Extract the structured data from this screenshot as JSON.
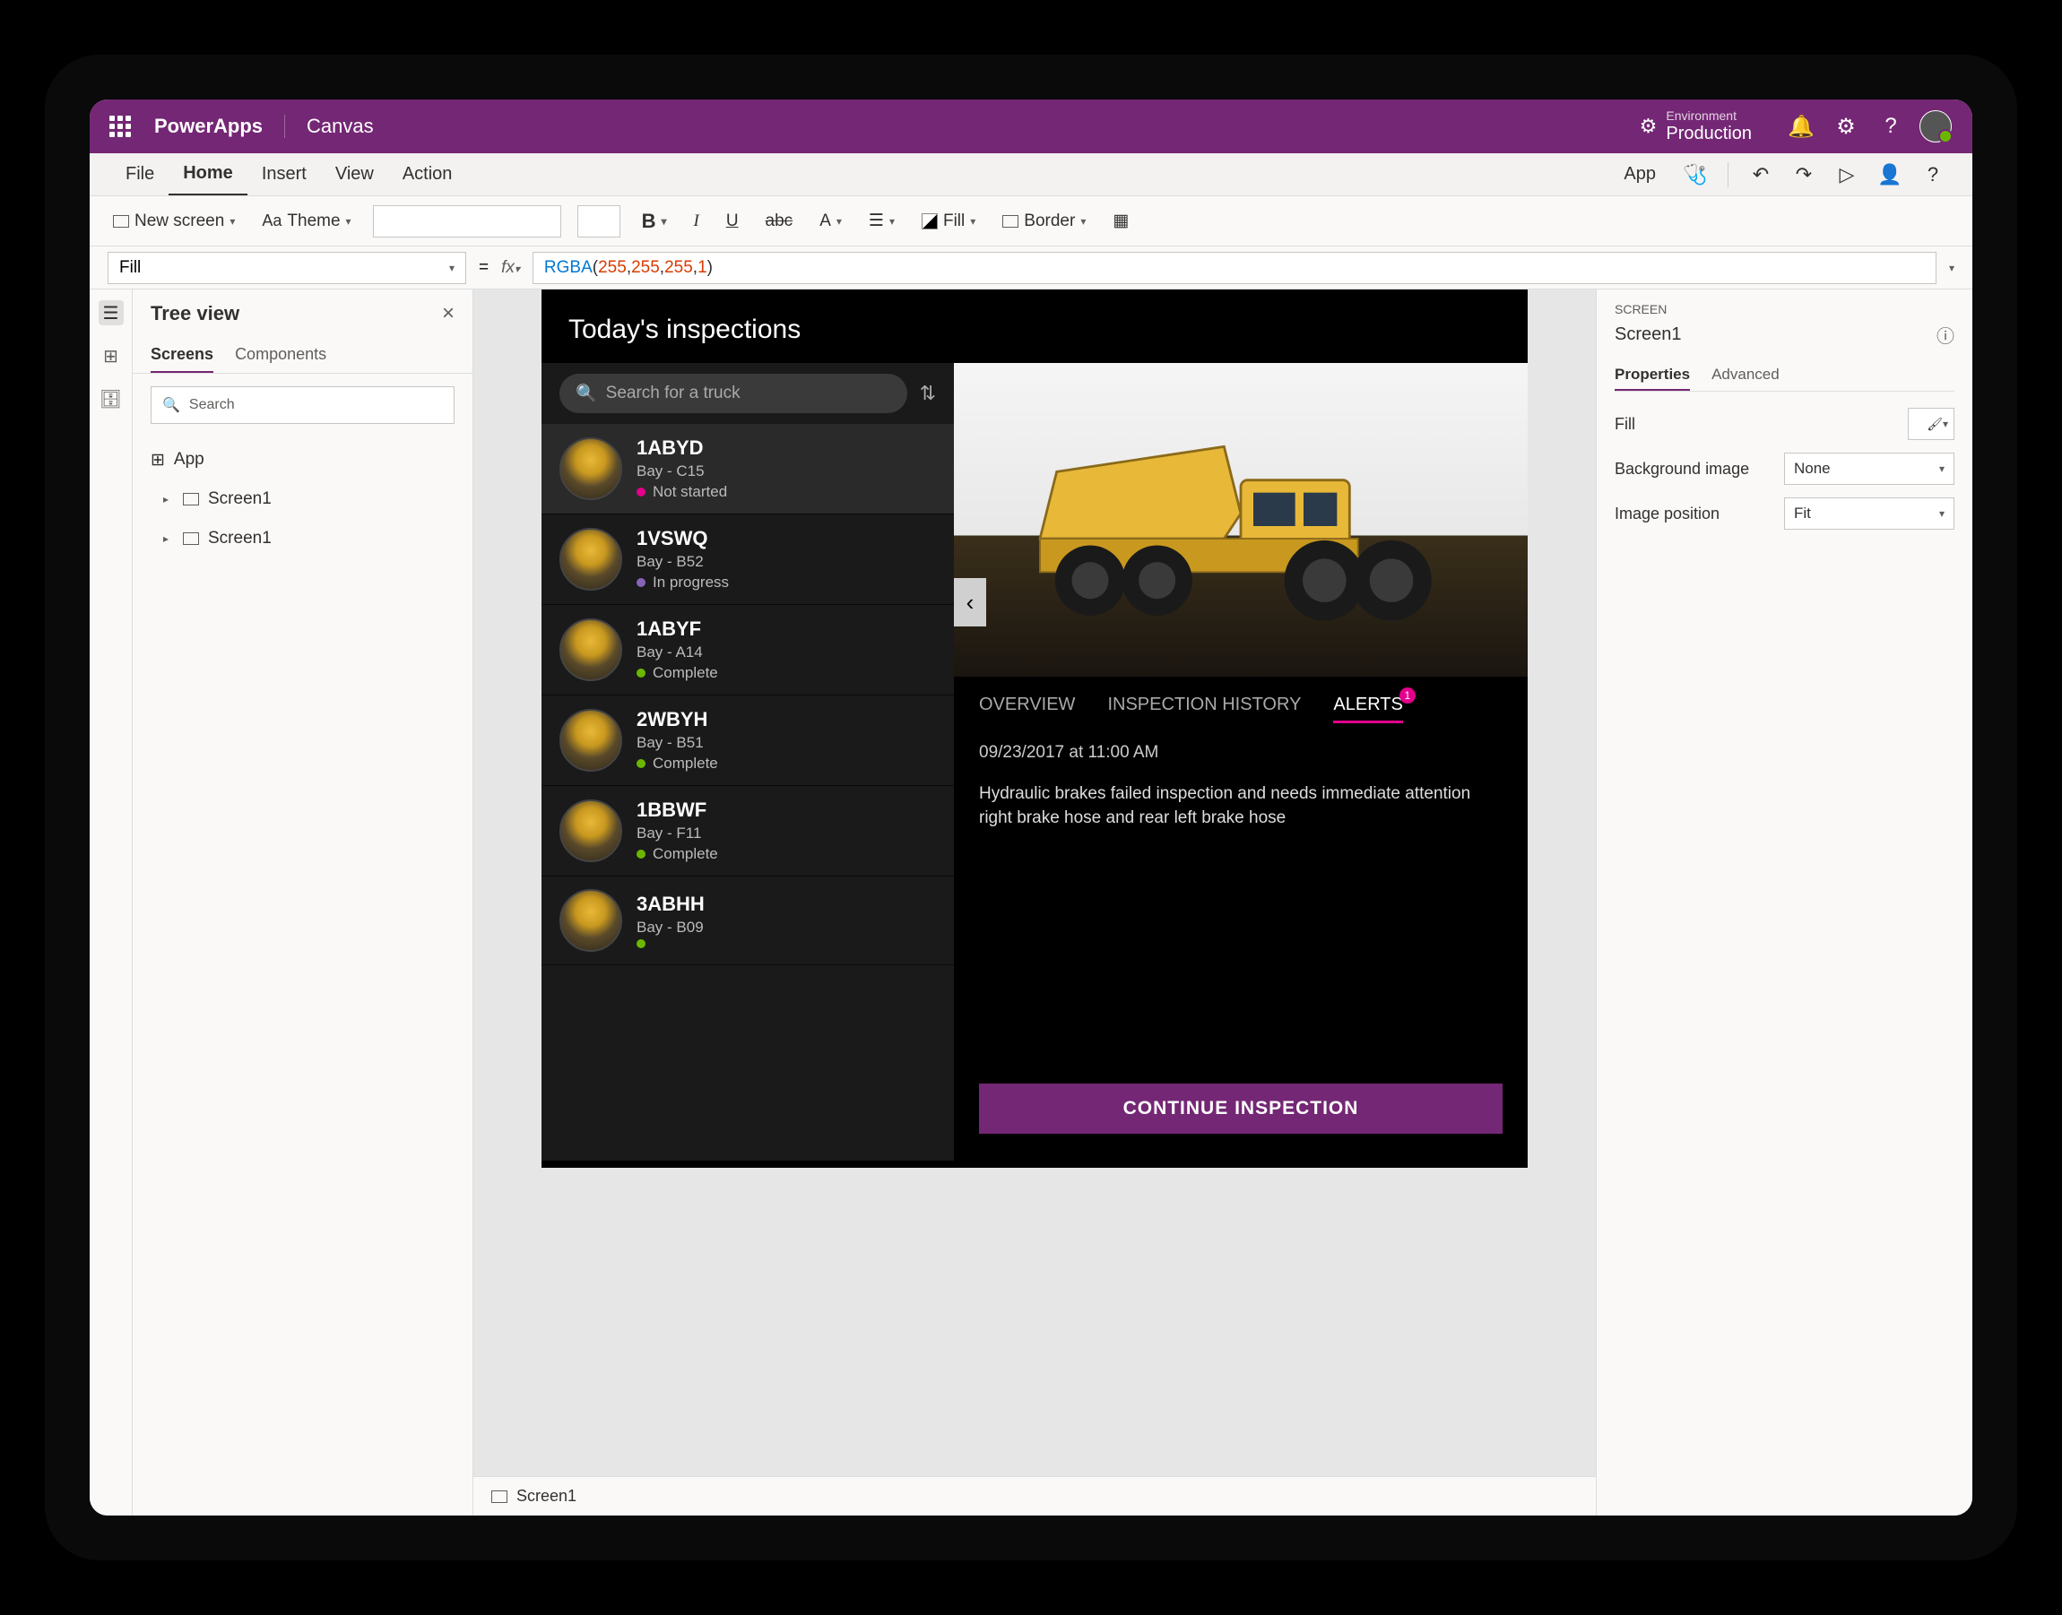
{
  "titlebar": {
    "brand": "PowerApps",
    "doctype": "Canvas",
    "env_label": "Environment",
    "env_name": "Production"
  },
  "menubar": {
    "items": [
      "File",
      "Home",
      "Insert",
      "View",
      "Action"
    ],
    "active": "Home",
    "app_label": "App"
  },
  "toolbar": {
    "newscreen": "New screen",
    "theme": "Theme",
    "fill": "Fill",
    "border": "Border"
  },
  "formula": {
    "property": "Fill",
    "fn": "RGBA",
    "args": [
      "255",
      "255",
      "255",
      "1"
    ]
  },
  "tree": {
    "title": "Tree view",
    "tabs": [
      "Screens",
      "Components"
    ],
    "active": "Screens",
    "search": "Search",
    "app": "App",
    "screens": [
      "Screen1",
      "Screen1"
    ]
  },
  "app": {
    "title": "Today's inspections",
    "search_placeholder": "Search for a truck",
    "trucks": [
      {
        "name": "1ABYD",
        "bay": "Bay - C15",
        "status": "Not started",
        "dot": "pink",
        "sel": true
      },
      {
        "name": "1VSWQ",
        "bay": "Bay - B52",
        "status": "In progress",
        "dot": "purple"
      },
      {
        "name": "1ABYF",
        "bay": "Bay - A14",
        "status": "Complete",
        "dot": "green"
      },
      {
        "name": "2WBYH",
        "bay": "Bay - B51",
        "status": "Complete",
        "dot": "green"
      },
      {
        "name": "1BBWF",
        "bay": "Bay - F11",
        "status": "Complete",
        "dot": "green"
      },
      {
        "name": "3ABHH",
        "bay": "Bay - B09",
        "status": "",
        "dot": "green"
      }
    ],
    "detail": {
      "tabs": [
        "OVERVIEW",
        "INSPECTION HISTORY",
        "ALERTS"
      ],
      "active": "ALERTS",
      "alert_badge": "1",
      "timestamp": "09/23/2017 at 11:00 AM",
      "desc": "Hydraulic brakes failed inspection and needs immediate attention right brake hose and rear left brake hose",
      "button": "CONTINUE INSPECTION"
    }
  },
  "statusbar": {
    "screen": "Screen1"
  },
  "proppanel": {
    "label": "SCREEN",
    "name": "Screen1",
    "tabs": [
      "Properties",
      "Advanced"
    ],
    "active": "Properties",
    "rows": [
      {
        "label": "Fill",
        "type": "color"
      },
      {
        "label": "Background image",
        "type": "select",
        "value": "None"
      },
      {
        "label": "Image position",
        "type": "select",
        "value": "Fit"
      }
    ]
  }
}
